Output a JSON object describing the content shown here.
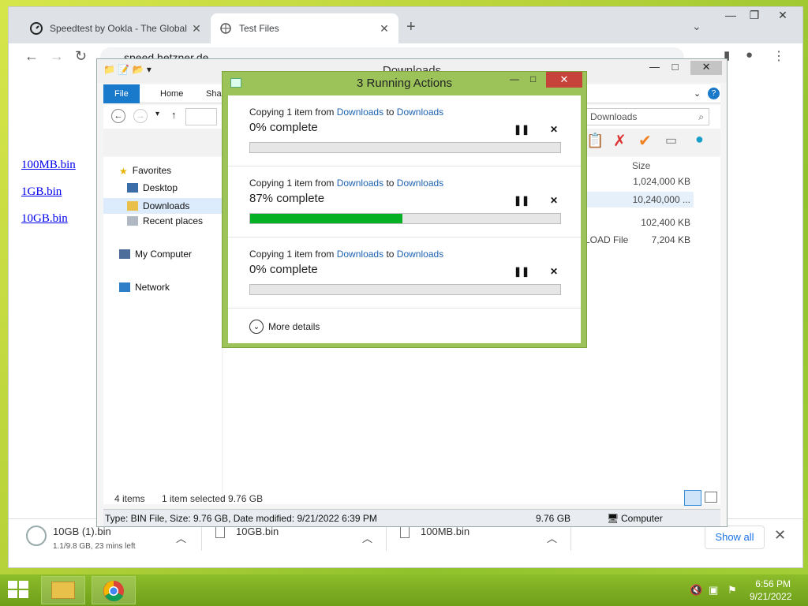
{
  "browser": {
    "tabs": [
      {
        "title": "Speedtest by Ookla - The Global",
        "icon": "speedtest-icon"
      },
      {
        "title": "Test Files",
        "icon": "globe-icon"
      }
    ],
    "url": "speed.hetzner.de",
    "links": [
      "100MB.bin",
      "1GB.bin",
      "10GB.bin"
    ]
  },
  "downloads": {
    "items": [
      {
        "name": "10GB (1).bin",
        "status": "1.1/9.8 GB, 23 mins left"
      },
      {
        "name": "10GB.bin",
        "status": ""
      },
      {
        "name": "100MB.bin",
        "status": ""
      }
    ],
    "show_all": "Show all"
  },
  "explorer": {
    "title": "Downloads",
    "ribbon_tabs": [
      "File",
      "Home",
      "Shar"
    ],
    "search_placeholder": "Downloads",
    "nav": {
      "favorites": "Favorites",
      "desktop": "Desktop",
      "downloads": "Downloads",
      "recent": "Recent places",
      "computer": "My Computer",
      "network": "Network"
    },
    "columns": {
      "size": "Size"
    },
    "sizes": [
      "1,024,000 KB",
      "10,240,000 ...",
      "102,400 KB",
      "7,204 KB"
    ],
    "type_fragment": "LOAD File",
    "status": {
      "items": "4 items",
      "selected": "1 item selected  9.76 GB"
    },
    "details": {
      "text": "Type: BIN File, Size: 9.76 GB, Date modified: 9/21/2022 6:39 PM",
      "size": "9.76 GB",
      "location": "Computer"
    }
  },
  "dialog": {
    "title": "3 Running Actions",
    "actions": [
      {
        "prefix": "Copying 1 item from",
        "from": "Downloads",
        "to_word": "to",
        "to": "Downloads",
        "percent_text": "0% complete",
        "progress": 0
      },
      {
        "prefix": "Copying 1 item from",
        "from": "Downloads",
        "to_word": "to",
        "to": "Downloads",
        "percent_text": "87% complete",
        "progress": 0.49
      },
      {
        "prefix": "Copying 1 item from",
        "from": "Downloads",
        "to_word": "to",
        "to": "Downloads",
        "percent_text": "0% complete",
        "progress": 0
      }
    ],
    "more_details": "More details"
  },
  "taskbar": {
    "time": "6:56 PM",
    "date": "9/21/2022"
  }
}
